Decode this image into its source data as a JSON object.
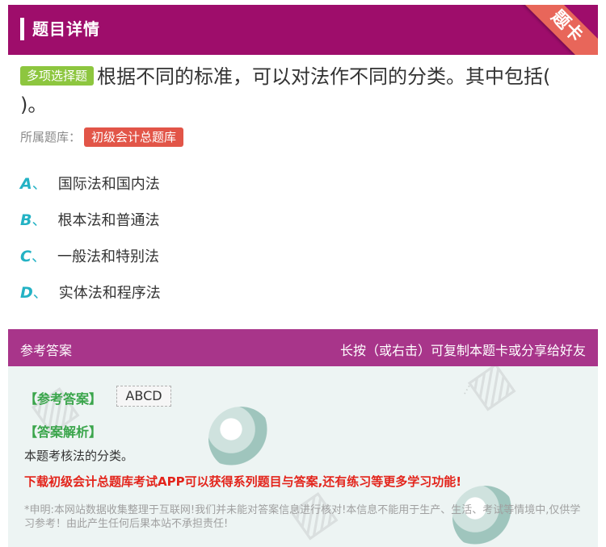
{
  "header": {
    "title": "题目详情",
    "ribbon": "题卡"
  },
  "question": {
    "type_tag": "多项选择题",
    "text_line1": "根据不同的标准，可以对法作不同的分类。其中包括(",
    "text_line2": ")。",
    "bank_label": "所属题库：",
    "bank_name": "初级会计总题库"
  },
  "options": [
    {
      "letter": "A",
      "sep": "、",
      "text": "国际法和国内法"
    },
    {
      "letter": "B",
      "sep": "、",
      "text": "根本法和普通法"
    },
    {
      "letter": "C",
      "sep": "、",
      "text": "一般法和特别法"
    },
    {
      "letter": "D",
      "sep": "、",
      "text": "实体法和程序法"
    }
  ],
  "answer_section": {
    "title": "参考答案",
    "share_hint": "长按（或右击）可复制本题卡或分享给好友",
    "answer_label": "【参考答案】",
    "answer_value": "ABCD",
    "explanation_label": "【答案解析】",
    "explanation_text": "本题考核法的分类。",
    "promo": "下载初级会计总题库考试APP可以获得系列题目与答案,还有练习等更多学习功能!",
    "disclaimer": "*申明:本网站数据收集整理于互联网!我们并未能对答案信息进行核对!本信息不能用于生产、生活、考试等情境中,仅供学习参考！由此产生任何后果本站不承担责任!"
  },
  "colors": {
    "header_bg": "#9e0d6b",
    "ribbon": "#e8665a",
    "type_tag": "#8dc63f",
    "bank_tag": "#e25548",
    "option_letter": "#23b2c4",
    "answer_header": "#a8358a",
    "label_green": "#3aa54b",
    "promo_red": "#e3241b"
  }
}
